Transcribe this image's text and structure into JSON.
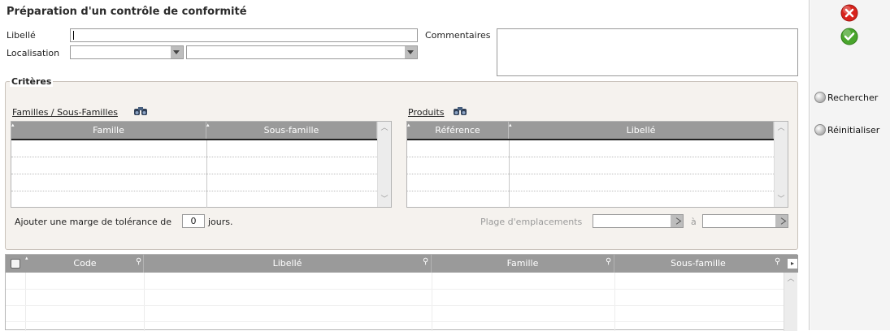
{
  "title": "Préparation d'un contrôle de conformité",
  "form": {
    "libelle_label": "Libellé",
    "libelle_value": "",
    "localisation_label": "Localisation",
    "commentaires_label": "Commentaires"
  },
  "criteres": {
    "legend": "Critères",
    "familles_link": "Familles / Sous-Familles",
    "familles_columns": [
      "Famille",
      "Sous-famille"
    ],
    "produits_link": "Produits",
    "produits_columns": [
      "Référence",
      "Libellé"
    ],
    "marge_prefix": "Ajouter une marge de tolérance de",
    "marge_value": "0",
    "marge_suffix": "jours.",
    "plage_label": "Plage d'emplacements",
    "plage_separator": "à"
  },
  "results": {
    "columns": [
      "Code",
      "Libellé",
      "Famille",
      "Sous-famille"
    ]
  },
  "actions": {
    "rechercher": "Rechercher",
    "reinitialiser": "Réinitialiser"
  },
  "icons": {
    "close": "close-icon",
    "validate": "checkmark-icon",
    "binoculars": "binoculars-icon",
    "search": "magnifier-icon"
  },
  "colors": {
    "close": "#d8231c",
    "validate": "#49a52c",
    "grid_header": "#9a9a9a",
    "panel_bg": "#f5f2ee"
  }
}
